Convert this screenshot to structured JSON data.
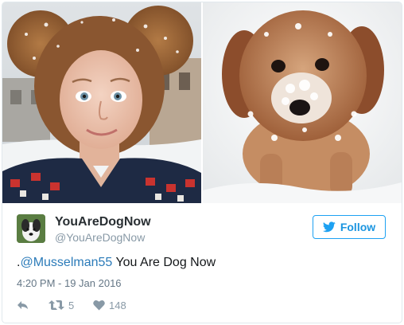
{
  "tweet": {
    "display_name": "YouAreDogNow",
    "handle": "@YouAreDogNow",
    "follow_label": "Follow",
    "text_prefix": ".",
    "mention": "@Musselman55",
    "text_suffix": " You Are Dog Now",
    "timestamp": "4:20 PM - 19 Jan 2016",
    "retweet_count": "5",
    "like_count": "148"
  },
  "colors": {
    "follow_blue": "#1da1f2",
    "mention_blue": "#2b7bb9",
    "muted_gray": "#8899a6",
    "name_dark": "#292f33"
  },
  "icons": {
    "follow": "twitter-bird-icon",
    "reply": "reply-arrow-icon",
    "retweet": "retweet-icon",
    "like": "heart-icon"
  }
}
